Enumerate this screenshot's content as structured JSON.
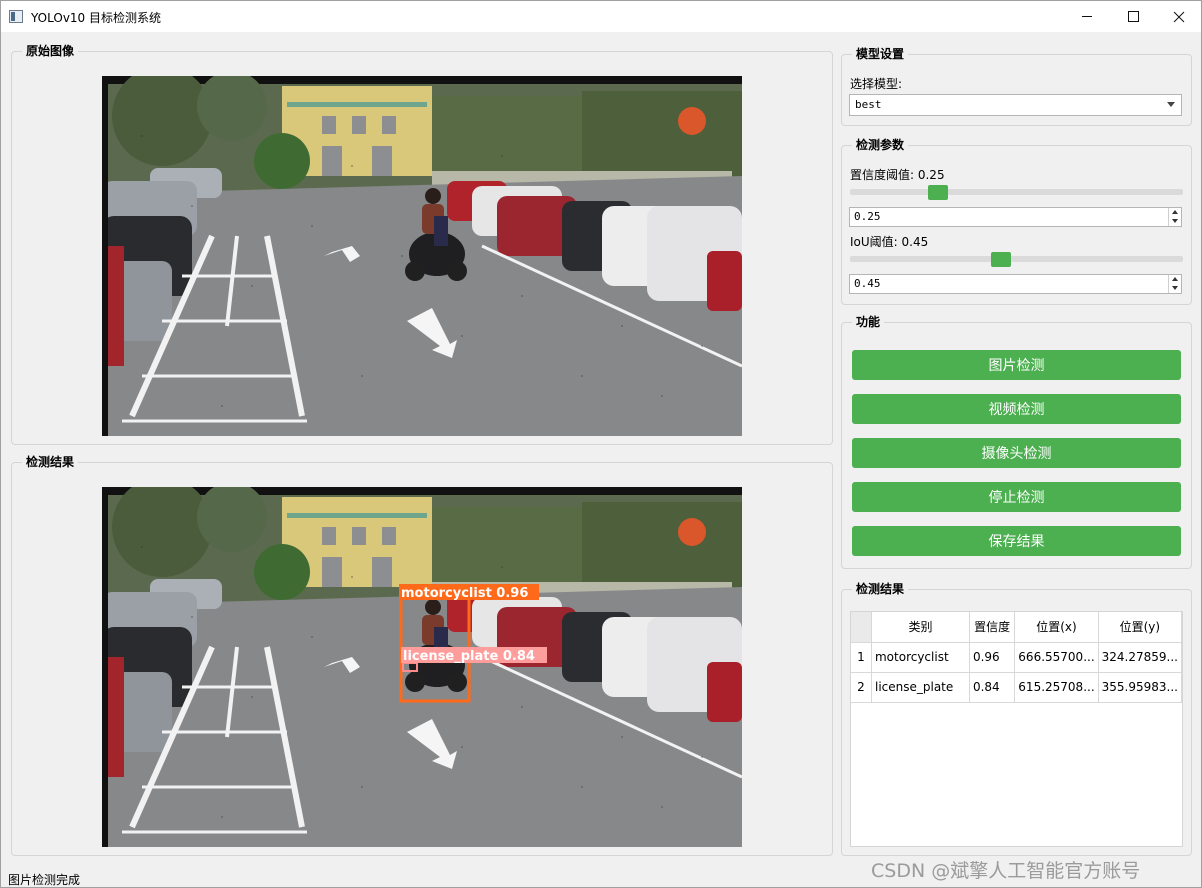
{
  "window": {
    "title": "YOLOv10 目标检测系统"
  },
  "left": {
    "original_title": "原始图像",
    "result_title": "检测结果"
  },
  "detection_boxes": [
    {
      "label": "motorcyclist 0.96",
      "color": "#ff6a1a"
    },
    {
      "label": "license_plate 0.84",
      "color": "#ff8a8a"
    }
  ],
  "model_settings": {
    "title": "模型设置",
    "select_label": "选择模型:",
    "selected_model": "best"
  },
  "params": {
    "title": "检测参数",
    "conf_label": "置信度阈值: 0.25",
    "conf_value": "0.25",
    "conf_level": 0.25,
    "iou_label": "IoU阈值: 0.45",
    "iou_value": "0.45",
    "iou_level": 0.45
  },
  "functions": {
    "title": "功能",
    "buttons": [
      "图片检测",
      "视频检测",
      "摄像头检测",
      "停止检测",
      "保存结果"
    ]
  },
  "results": {
    "title": "检测结果",
    "headers": [
      "类别",
      "置信度",
      "位置(x)",
      "位置(y)"
    ],
    "rows": [
      {
        "num": "1",
        "cls": "motorcyclist",
        "conf": "0.96",
        "x": "666.55700...",
        "y": "324.27859..."
      },
      {
        "num": "2",
        "cls": "license_plate",
        "conf": "0.84",
        "x": "615.25708...",
        "y": "355.95983..."
      }
    ]
  },
  "status_text": "图片检测完成",
  "watermark": "CSDN @斌擎人工智能官方账号",
  "accent_color": "#4caf50"
}
